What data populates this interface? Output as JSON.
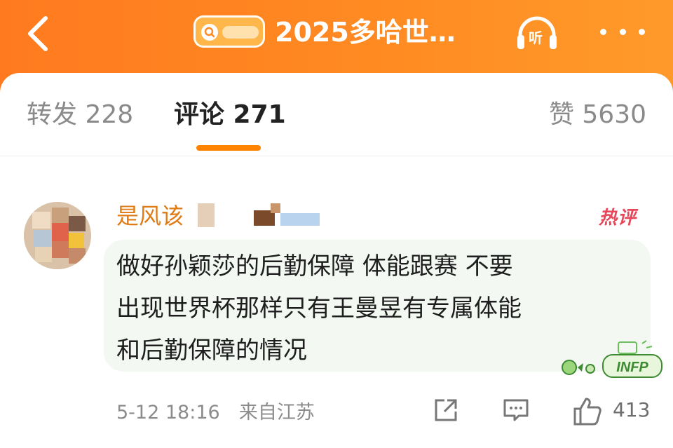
{
  "header": {
    "title": "2025多哈世…",
    "listen_label": "听"
  },
  "tabs": {
    "repost": "转发 228",
    "comment": "评论 271",
    "like": "赞 5630"
  },
  "comment": {
    "username": "是风该",
    "hot_label": "热评",
    "text_lines": [
      "做好孙颖莎的后勤保障 体能跟赛 不要",
      "出现世界杯那样只有王曼昱有专属体能",
      "和后勤保障的情况"
    ],
    "badge_text": "INFP",
    "time": "5-12 18:16",
    "location": "来自江苏",
    "like_count": "413"
  },
  "colors": {
    "accent": "#ff8200",
    "header_bg": "#ff7a1f",
    "username": "#e07a13",
    "hot": "#e8465b"
  },
  "icons": [
    "back-icon",
    "search-icon",
    "headphones-icon",
    "more-icon",
    "share-icon",
    "reply-icon",
    "thumbs-up-icon"
  ]
}
